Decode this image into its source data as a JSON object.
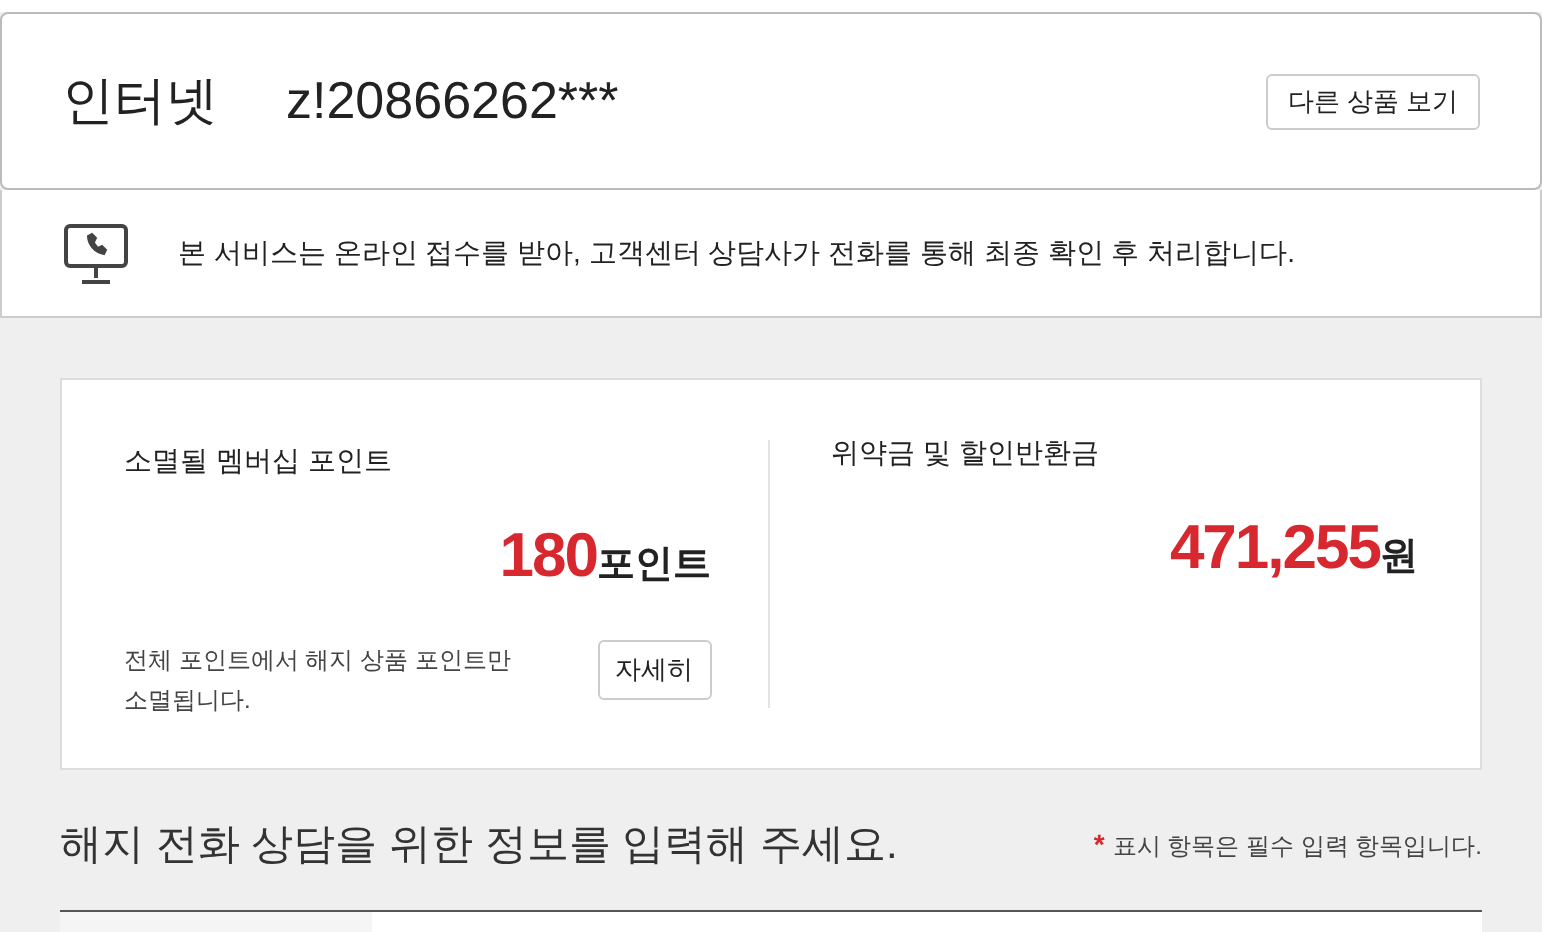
{
  "header": {
    "product": "인터넷",
    "account": "z!20866262***",
    "button": "다른 상품 보기"
  },
  "notice": {
    "text": "본 서비스는 온라인 접수를 받아, 고객센터 상담사가 전화를 통해 최종 확인 후 처리합니다."
  },
  "summary": [
    {
      "label": "소멸될 멤버십 포인트",
      "amount": "180",
      "unit": "포인트",
      "note": "전체 포인트에서 해지 상품 포인트만 소멸됩니다.",
      "button": "자세히"
    },
    {
      "label": "위약금 및 할인반환금",
      "amount": "471,255",
      "unit": "원"
    }
  ],
  "form": {
    "title": "해지 전화 상담을 위한 정보를 입력해 주세요.",
    "required_mark": "*",
    "required_note": "표시 항목은 필수 입력 항목입니다."
  }
}
